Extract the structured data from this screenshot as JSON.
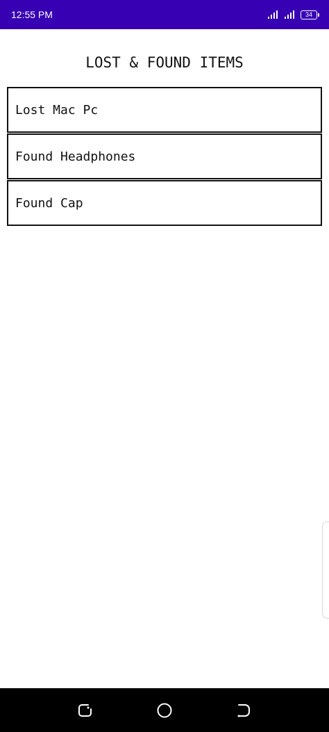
{
  "status_bar": {
    "time": "12:55 PM",
    "battery_level": "34",
    "background_color": "#3700b3",
    "icons": [
      "signal-icon",
      "signal-icon",
      "battery-icon"
    ]
  },
  "page": {
    "title": "LOST & FOUND ITEMS"
  },
  "items": [
    {
      "label": "Lost Mac Pc"
    },
    {
      "label": "Found Headphones"
    },
    {
      "label": "Found Cap"
    }
  ],
  "nav_bar": {
    "buttons": [
      "recent-apps-icon",
      "home-icon",
      "back-icon"
    ]
  }
}
